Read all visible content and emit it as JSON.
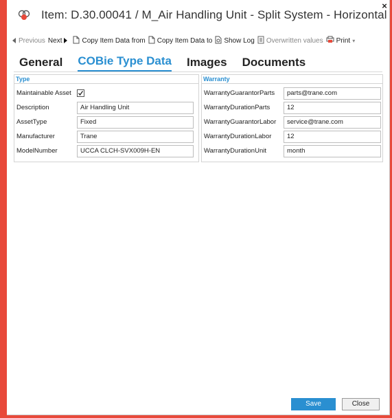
{
  "window": {
    "title": "Item: D.30.00041 / M_Air Handling Unit - Split System - Horizontal",
    "close_glyph": "×"
  },
  "toolbar": {
    "previous": "Previous",
    "next": "Next",
    "copy_from": "Copy Item Data from",
    "copy_to": "Copy Item Data to",
    "show_log": "Show Log",
    "overwritten": "Overwritten values",
    "print": "Print"
  },
  "tabs": [
    {
      "label": "General",
      "active": false
    },
    {
      "label": "COBie Type Data",
      "active": true
    },
    {
      "label": "Images",
      "active": false
    },
    {
      "label": "Documents",
      "active": false
    }
  ],
  "type_group": {
    "title": "Type",
    "maintainable_label": "Maintainable Asset",
    "maintainable_checked": true,
    "fields": [
      {
        "label": "Description",
        "value": "Air Handling Unit"
      },
      {
        "label": "AssetType",
        "value": "Fixed"
      },
      {
        "label": "Manufacturer",
        "value": "Trane"
      },
      {
        "label": "ModelNumber",
        "value": "UCCA CLCH-SVX009H-EN"
      }
    ]
  },
  "warranty_group": {
    "title": "Warranty",
    "fields": [
      {
        "label": "WarrantyGuarantorParts",
        "value": "parts@trane.com"
      },
      {
        "label": "WarrantyDurationParts",
        "value": "12"
      },
      {
        "label": "WarrantyGuarantorLabor",
        "value": "service@trane.com"
      },
      {
        "label": "WarrantyDurationLabor",
        "value": "12"
      },
      {
        "label": "WarrantyDurationUnit",
        "value": "month"
      }
    ]
  },
  "footer": {
    "save": "Save",
    "close": "Close"
  },
  "colors": {
    "accent": "#2a8fd1",
    "backdrop": "#e8493a"
  }
}
